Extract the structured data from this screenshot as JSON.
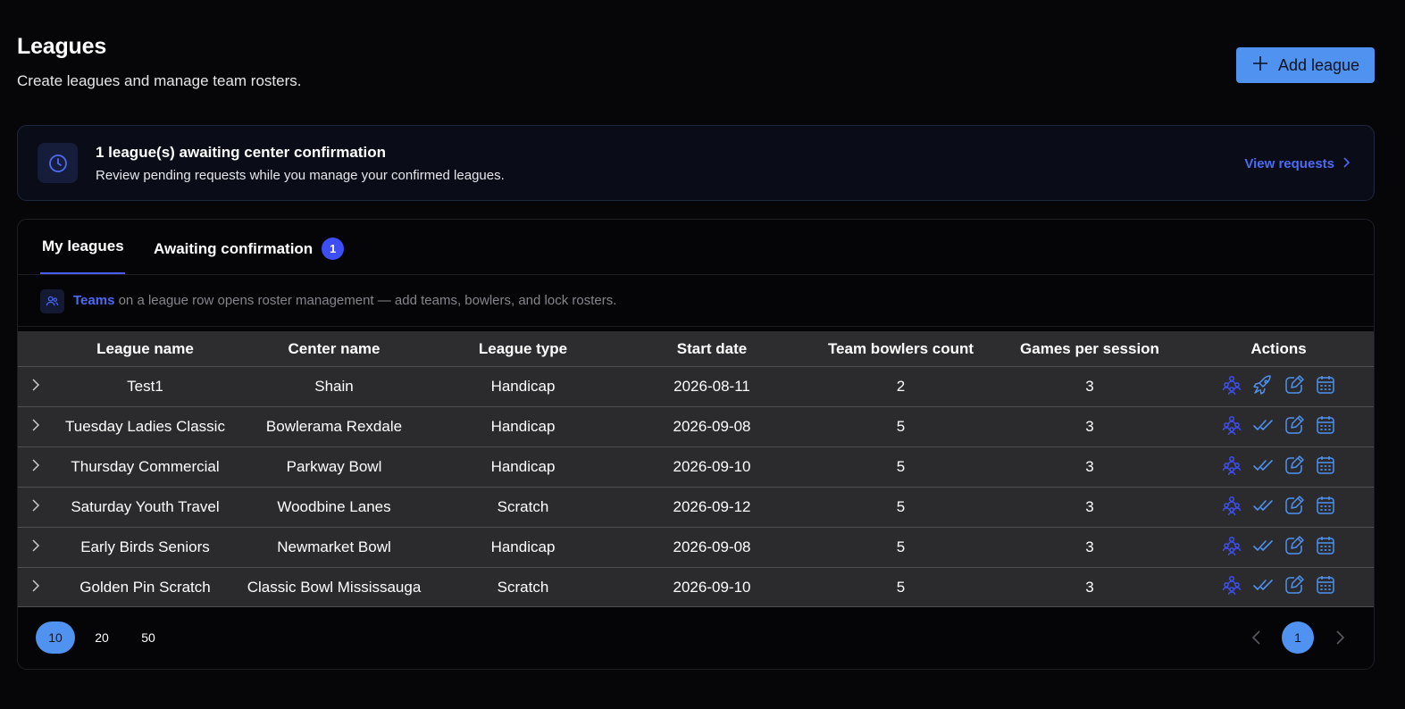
{
  "header": {
    "title": "Leagues",
    "subtitle": "Create leagues and manage team rosters.",
    "add_button_label": "Add league"
  },
  "banner": {
    "title": "1 league(s) awaiting center confirmation",
    "text": "Review pending requests while you manage your confirmed leagues.",
    "link_label": "View requests"
  },
  "tabs": {
    "my_leagues": "My leagues",
    "awaiting": "Awaiting confirmation",
    "awaiting_count": "1"
  },
  "hint": {
    "strong": "Teams",
    "text": " on a league row opens roster management — add teams, bowlers, and lock rosters."
  },
  "table": {
    "headers": [
      "League name",
      "Center name",
      "League type",
      "Start date",
      "Team bowlers count",
      "Games per session",
      "Actions"
    ],
    "rows": [
      {
        "league": "Test1",
        "center": "Shain",
        "type": "Handicap",
        "start": "2026-08-11",
        "bowlers": "2",
        "games": "3",
        "status_action": "rocket-icon"
      },
      {
        "league": "Tuesday Ladies Classic",
        "center": "Bowlerama Rexdale",
        "type": "Handicap",
        "start": "2026-09-08",
        "bowlers": "5",
        "games": "3",
        "status_action": "double-check-icon"
      },
      {
        "league": "Thursday Commercial",
        "center": "Parkway Bowl",
        "type": "Handicap",
        "start": "2026-09-10",
        "bowlers": "5",
        "games": "3",
        "status_action": "double-check-icon"
      },
      {
        "league": "Saturday Youth Travel",
        "center": "Woodbine Lanes",
        "type": "Scratch",
        "start": "2026-09-12",
        "bowlers": "5",
        "games": "3",
        "status_action": "double-check-icon"
      },
      {
        "league": "Early Birds Seniors",
        "center": "Newmarket Bowl",
        "type": "Handicap",
        "start": "2026-09-08",
        "bowlers": "5",
        "games": "3",
        "status_action": "double-check-icon"
      },
      {
        "league": "Golden Pin Scratch",
        "center": "Classic Bowl Mississauga",
        "type": "Scratch",
        "start": "2026-09-10",
        "bowlers": "5",
        "games": "3",
        "status_action": "double-check-icon"
      }
    ]
  },
  "pagination": {
    "sizes": [
      "10",
      "20",
      "50"
    ],
    "active_size": "10",
    "current_page": "1"
  },
  "colors": {
    "accent": "#4f92f0",
    "link": "#4c6bf5",
    "teams_icon": "#3d4ff2",
    "action_icon": "#4f92f0",
    "row_bg": "#2b2b2d"
  }
}
